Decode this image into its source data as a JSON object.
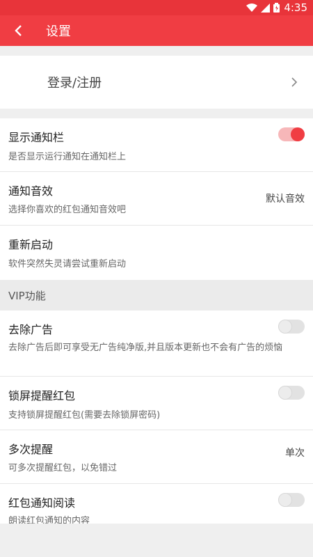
{
  "status_bar": {
    "time": "4:35"
  },
  "app_bar": {
    "title": "设置"
  },
  "login": {
    "label": "登录/注册"
  },
  "general": [
    {
      "title": "显示通知栏",
      "subtitle": "是否显示运行通知在通知栏上",
      "toggle": "on"
    },
    {
      "title": "通知音效",
      "subtitle": "选择你喜欢的红包通知音效吧",
      "value": "默认音效"
    },
    {
      "title": "重新启动",
      "subtitle": "软件突然失灵请尝试重新启动"
    }
  ],
  "vip_section": {
    "header": "VIP功能"
  },
  "vip": [
    {
      "title": "去除广告",
      "subtitle": "去除广告后即可享受无广告纯净版,并且版本更新也不会有广告的烦恼",
      "toggle": "off"
    },
    {
      "title": "锁屏提醒红包",
      "subtitle": "支持锁屏提醒红包(需要去除锁屏密码)",
      "toggle": "off"
    },
    {
      "title": "多次提醒",
      "subtitle": "可多次提醒红包，以免错过",
      "value": "单次"
    },
    {
      "title": "红包通知阅读",
      "subtitle": "朗读红包通知的内容",
      "toggle": "off"
    }
  ],
  "colors": {
    "accent": "#f03d43",
    "status_bar": "#e8343a",
    "background": "#efefef"
  },
  "icons": {
    "back": "back-arrow-icon",
    "chevron": "chevron-right-icon",
    "wifi": "wifi-icon",
    "signal": "signal-icon",
    "battery": "battery-icon"
  }
}
